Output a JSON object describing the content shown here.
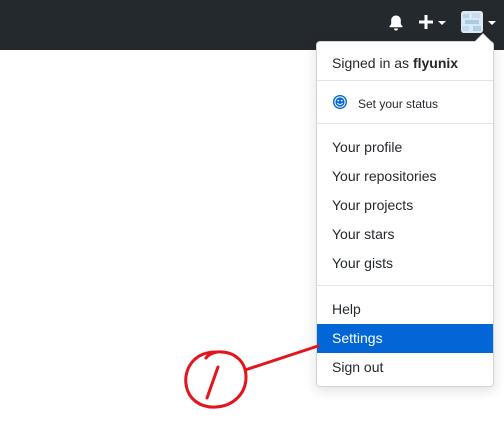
{
  "header": {
    "icons": [
      "bell-icon",
      "plus-icon",
      "avatar"
    ]
  },
  "dropdown": {
    "signed_in_prefix": "Signed in as",
    "username": "flyunix",
    "status_label": "Set your status",
    "items_group1": [
      "Your profile",
      "Your repositories",
      "Your projects",
      "Your stars",
      "Your gists"
    ],
    "items_group2": [
      "Help",
      "Settings",
      "Sign out"
    ],
    "active_item": "Settings"
  },
  "colors": {
    "topbar": "#24292e",
    "accent": "#0366d6",
    "annotation": "#e3141b"
  }
}
